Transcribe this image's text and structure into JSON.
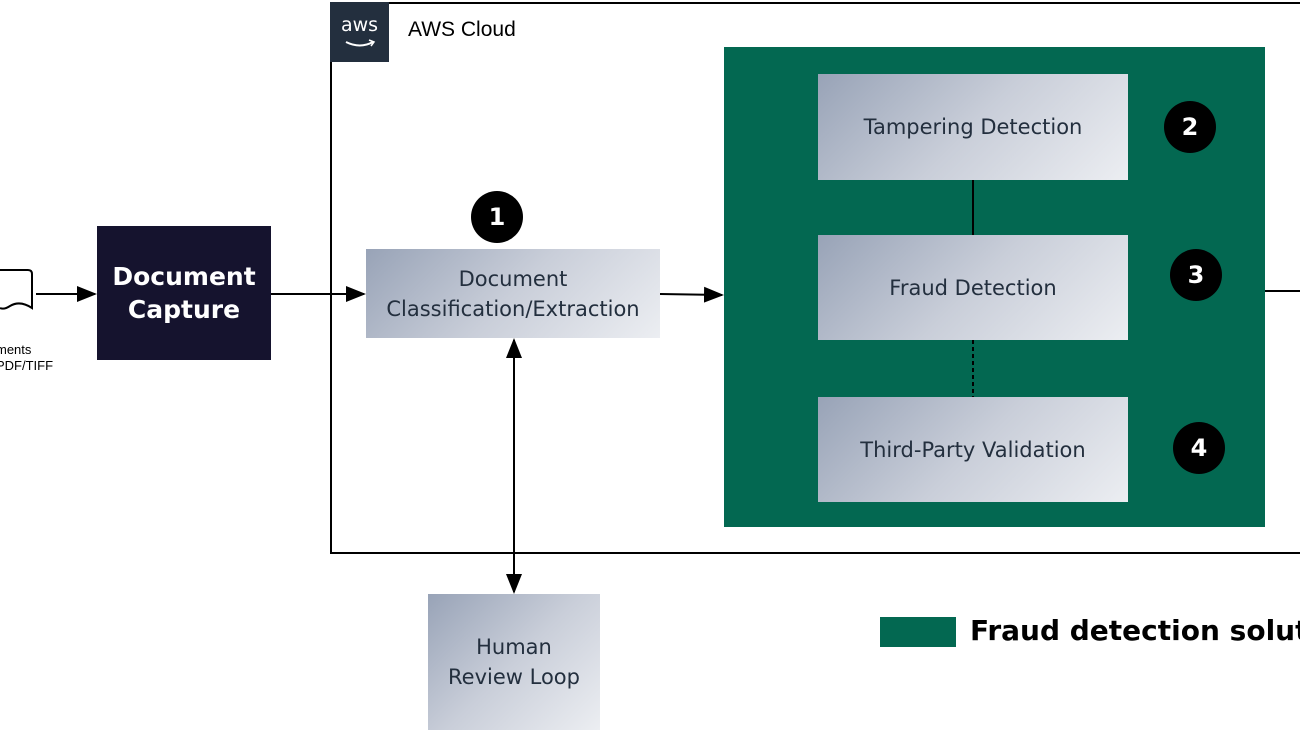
{
  "source": {
    "label_line1": "ments",
    "label_line2": "PDF/TIFF",
    "icon": "document-icon"
  },
  "cloud": {
    "title": "AWS Cloud",
    "logo_text": "aws"
  },
  "nodes": {
    "capture": "Document Capture",
    "classification": "Document Classification/Extraction",
    "tampering": "Tampering Detection",
    "fraud": "Fraud Detection",
    "third_party": "Third-Party Validation",
    "human_review": "Human Review Loop"
  },
  "badges": [
    "1",
    "2",
    "3",
    "4"
  ],
  "legend": {
    "label": "Fraud detection soluti",
    "color": "#036851"
  },
  "colors": {
    "green": "#036851",
    "navy": "#15132e",
    "aws_dark": "#232f3e"
  }
}
